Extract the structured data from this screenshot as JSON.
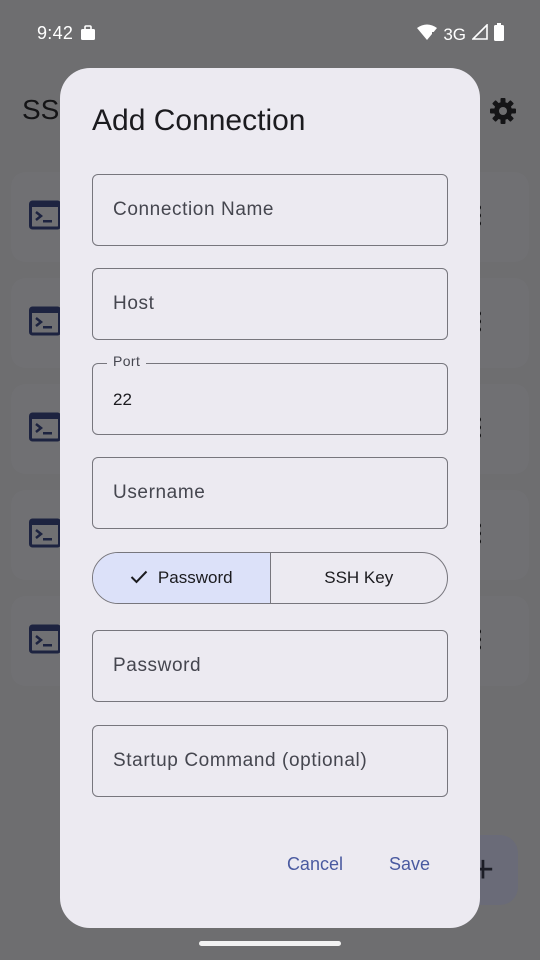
{
  "status_bar": {
    "time": "9:42",
    "network": "3G"
  },
  "background": {
    "title": "SSH",
    "card_count": 5,
    "fab_label": "+"
  },
  "dialog": {
    "title": "Add Connection",
    "fields": {
      "connection_name": {
        "placeholder": "Connection Name"
      },
      "host": {
        "placeholder": "Host"
      },
      "port": {
        "label": "Port",
        "value": "22"
      },
      "username": {
        "placeholder": "Username"
      },
      "password": {
        "placeholder": "Password"
      },
      "startup_command": {
        "placeholder": "Startup Command (optional)"
      }
    },
    "auth_toggle": {
      "options": [
        "Password",
        "SSH Key"
      ],
      "selected": "Password"
    },
    "actions": {
      "cancel": "Cancel",
      "save": "Save"
    }
  },
  "colors": {
    "scrim": "#6e6e70",
    "dialog_bg": "#eceaf1",
    "selected_segment": "#dce1f9",
    "accent_text": "#4a5aa0",
    "outline": "#77767d"
  },
  "icons": [
    "briefcase-icon",
    "wifi-icon",
    "signal-icon",
    "battery-icon",
    "gear-icon",
    "terminal-icon",
    "more-vert-icon",
    "check-icon",
    "add-icon"
  ]
}
